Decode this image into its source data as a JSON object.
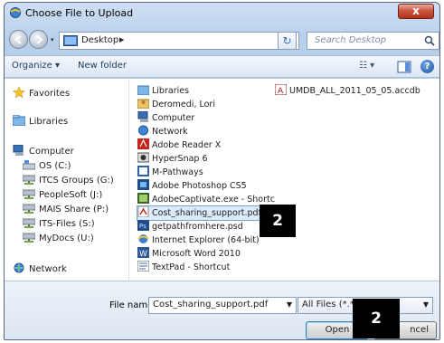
{
  "window": {
    "title": "Choose File to Upload",
    "close_label": "x"
  },
  "address": {
    "location": "Desktop",
    "separator": "▶"
  },
  "search": {
    "placeholder": "Search Desktop"
  },
  "toolbar": {
    "organize_label": "Organize ▾",
    "new_folder_label": "New folder"
  },
  "nav_pane": {
    "favorites": "Favorites",
    "libraries": "Libraries",
    "computer": "Computer",
    "drives": [
      "OS (C:)",
      "ITCS Groups (G:)",
      "PeopleSoft (J:)",
      "MAIS Share (P:)",
      "ITS-Files (S:)",
      "MyDocs (U:)"
    ],
    "network": "Network"
  },
  "files": {
    "column1": [
      "Libraries",
      "Deromedi, Lori",
      "Computer",
      "Network",
      "Adobe Reader X",
      "HyperSnap 6",
      "M-Pathways",
      "Adobe Photoshop CS5",
      "AdobeCaptivate.exe - Shortc",
      "Cost_sharing_support.pdf",
      "getpathfromhere.psd",
      "Internet Explorer (64-bit)",
      "Microsoft Word 2010",
      "TextPad - Shortcut"
    ],
    "column2": [
      "UMDB_ALL_2011_05_05.accdb"
    ],
    "selected": "Cost_sharing_support.pdf"
  },
  "bottom": {
    "file_name_label": "File name:",
    "file_name_value": "Cost_sharing_support.pdf",
    "file_type_value": "All Files (*.*)",
    "open_label": "Open",
    "cancel_label": "Cancel",
    "cancel_visible_fragment": "ncel"
  },
  "overlays": {
    "step_a": "2",
    "step_b": "2"
  },
  "colors": {
    "accent": "#2f6fc4",
    "selection": "#dcebfc",
    "close": "#c8503a"
  }
}
